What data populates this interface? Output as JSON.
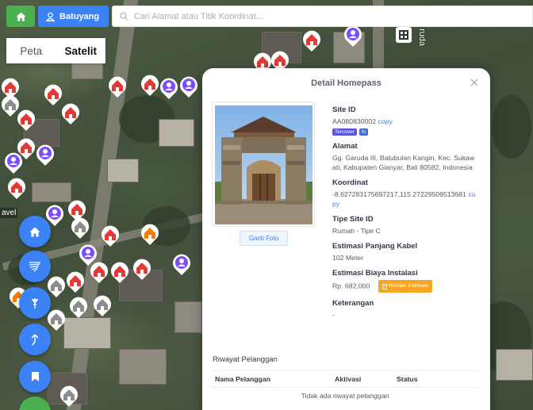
{
  "topbar": {
    "area_label": "Batuyang",
    "search_placeholder": "Cari Alamat atau Titik Koordinat..."
  },
  "map_type": {
    "map_label": "Peta",
    "satellite_label": "Satelit",
    "selected": "Satelit"
  },
  "map": {
    "place_label": "avel",
    "road_label": "ruda"
  },
  "panel": {
    "title": "Detail Homepass",
    "photo_button": "Ganti Foto",
    "site_id": {
      "label": "Site ID",
      "value": "AA080830002",
      "copy": "copy"
    },
    "badges": [
      "Tercover",
      "fo"
    ],
    "alamat": {
      "label": "Alamat",
      "value": "Gg. Garuda III, Batubulan Kangin, Kec. Sukawati, Kabupaten Gianyar, Bali 80582, Indonesia"
    },
    "koordinat": {
      "label": "Koordinat",
      "value": "-8.627283175697217,115.27229509513681",
      "copy": "copy"
    },
    "tipe": {
      "label": "Tipe Site ID",
      "value": "Rumah - Tipe C"
    },
    "kabel": {
      "label": "Estimasi Panjang Kabel",
      "value": "102 Meter"
    },
    "biaya": {
      "label": "Estimasi Biaya Instalasi",
      "value": "Rp. 682,000",
      "button": "Rincian Estimasi"
    },
    "keterangan": {
      "label": "Keterangan",
      "value": "-"
    },
    "riwayat": {
      "title": "Riwayat Pelanggan",
      "columns": [
        "Nama Pelanggan",
        "Aktivasi",
        "Status"
      ],
      "empty": "Tidak ada riwayat pelanggan"
    }
  },
  "colors": {
    "primary": "#3b82f6",
    "success": "#4caf50",
    "warning": "#f5a623",
    "pin_red": "#e53935",
    "pin_grey": "#8d8d8d",
    "pin_orange": "#f57c00"
  }
}
